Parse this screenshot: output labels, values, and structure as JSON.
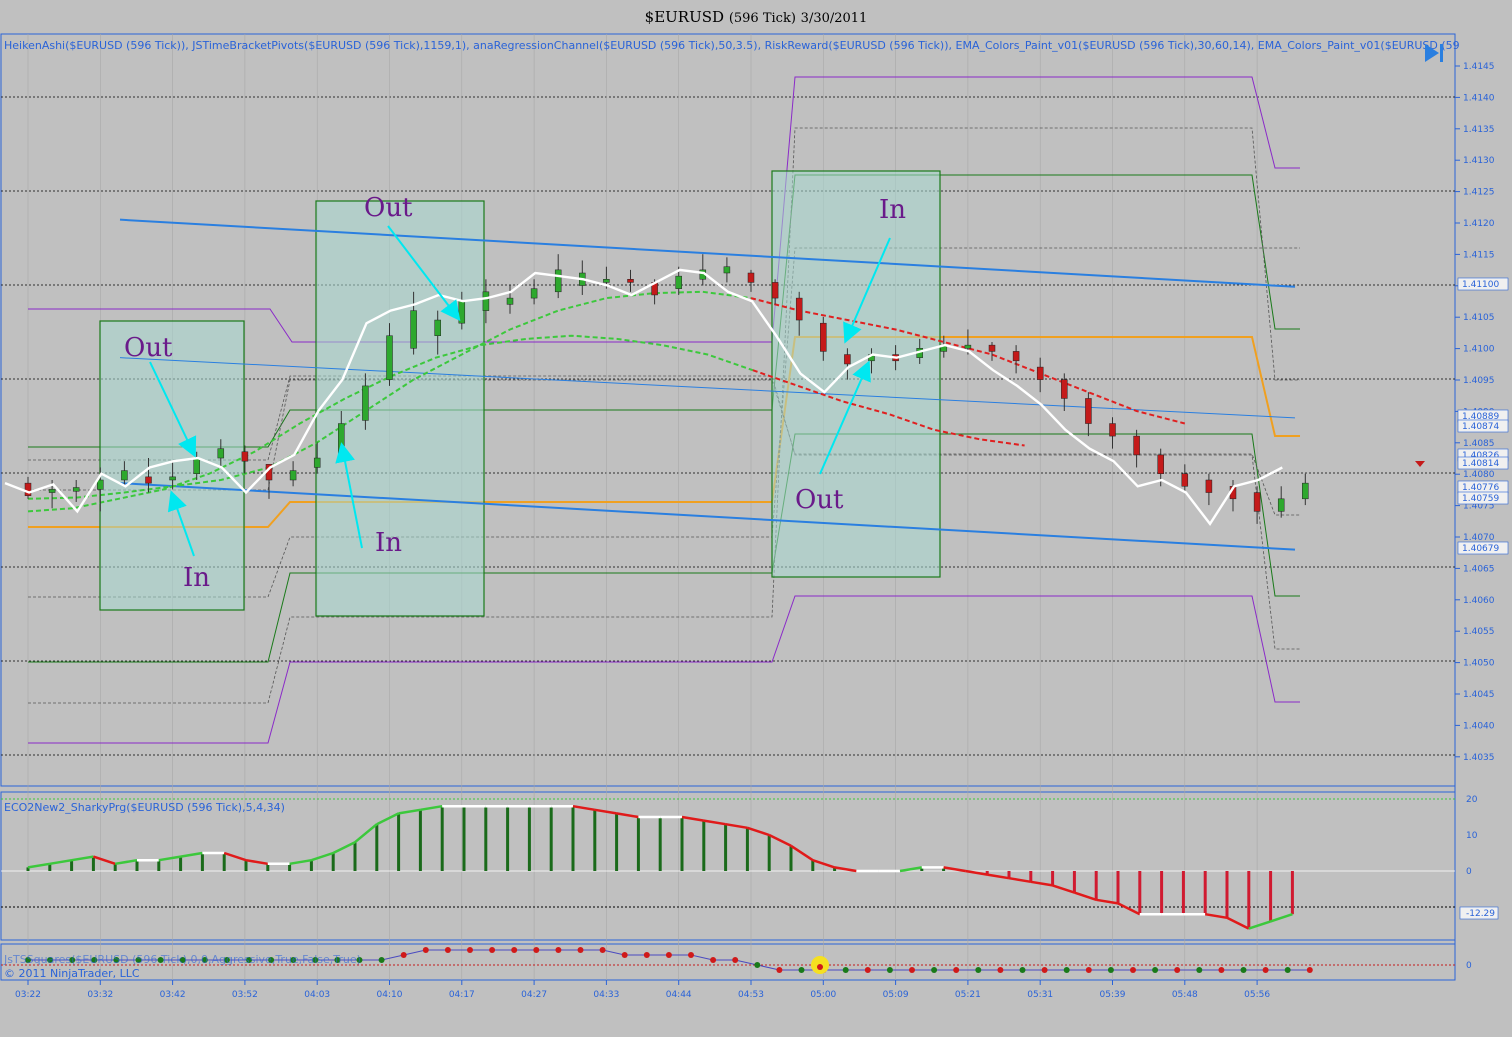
{
  "window": {
    "title_symbol": "$EURUSD",
    "title_period": "(596 Tick)",
    "title_date": "3/30/2011"
  },
  "panels": {
    "price_indicators_label": "HeikenAshi($EURUSD (596 Tick)), JSTimeBracketPivots($EURUSD (596 Tick),1159,1), anaRegressionChannel($EURUSD (596 Tick),50,3.5), RiskReward($EURUSD (596 Tick)), EMA_Colors_Paint_v01($EURUSD (596 Tick),30,60,14), EMA_Colors_Paint_v01($EURUSD (59",
    "osc_label": "ECO2New2_SharkyPrg($EURUSD (596 Tick),5,4,34)",
    "bottom_label": "JsTSSquares($EURUSD (596 Tick),0,0,Aggressive,True,False,True)",
    "copyright": "© 2011 NinjaTrader, LLC"
  },
  "colors": {
    "background": "#c0c0c0",
    "axis_text": "#2a63d8",
    "regression": "#2a7fe0",
    "annotation": "#6a1a8a",
    "arrow": "#00e8f0",
    "up_bar": "#2ea82e",
    "down_bar": "#c41a1a"
  },
  "chart_data": {
    "type": "candlestick",
    "x_tick_labels": [
      "03:22",
      "03:32",
      "03:42",
      "03:52",
      "04:03",
      "04:10",
      "04:17",
      "04:27",
      "04:33",
      "04:44",
      "04:53",
      "05:00",
      "05:09",
      "05:21",
      "05:31",
      "05:39",
      "05:48",
      "05:56"
    ],
    "y_tick_labels": [
      "1.4145",
      "1.4140",
      "1.4135",
      "1.4130",
      "1.4125",
      "1.4120",
      "1.4115",
      "1.4110",
      "1.4105",
      "1.4100",
      "1.4095",
      "1.4090",
      "1.4085",
      "1.4080",
      "1.4075",
      "1.4070",
      "1.4065",
      "1.4060",
      "1.4055",
      "1.4050",
      "1.4045",
      "1.4040",
      "1.4035"
    ],
    "price_labels": [
      "1.41100",
      "1.40889",
      "1.40874",
      "1.40826",
      "1.40814",
      "1.40776",
      "1.40759",
      "1.40679"
    ],
    "ylim": [
      1.40325,
      1.41475
    ],
    "osc_tick_labels": [
      "20",
      "10",
      "0",
      "-12.29"
    ],
    "bottom_tick_labels": [
      "0"
    ],
    "annotations": [
      "Out",
      "In",
      "Out",
      "In",
      "In",
      "Out"
    ],
    "regression_channel": {
      "upper": [
        [
          120,
          1.41205
        ],
        [
          1295,
          1.41098
        ]
      ],
      "lower": [
        [
          120,
          1.40785
        ],
        [
          1295,
          1.40679
        ]
      ],
      "middle": [
        [
          120,
          1.40985
        ],
        [
          1295,
          1.40889
        ]
      ]
    },
    "candles": [
      [
        1.40785,
        1.40765,
        1.40795,
        1.4076
      ],
      [
        1.4077,
        1.40775,
        1.4079,
        1.40745
      ],
      [
        1.40772,
        1.40778,
        1.4079,
        1.40755
      ],
      [
        1.40775,
        1.4079,
        1.4081,
        1.4074
      ],
      [
        1.4079,
        1.40805,
        1.4082,
        1.4078
      ],
      [
        1.40795,
        1.40785,
        1.40825,
        1.4077
      ],
      [
        1.4079,
        1.40795,
        1.4082,
        1.40775
      ],
      [
        1.408,
        1.40825,
        1.40835,
        1.4079
      ],
      [
        1.40825,
        1.4084,
        1.40855,
        1.4081
      ],
      [
        1.40835,
        1.4082,
        1.40845,
        1.408
      ],
      [
        1.40815,
        1.4079,
        1.40815,
        1.4076
      ],
      [
        1.4079,
        1.40805,
        1.4082,
        1.4078
      ],
      [
        1.4081,
        1.40825,
        1.4085,
        1.408
      ],
      [
        1.4083,
        1.4088,
        1.409,
        1.4082
      ],
      [
        1.40885,
        1.4094,
        1.4096,
        1.4087
      ],
      [
        1.4095,
        1.4102,
        1.4104,
        1.4094
      ],
      [
        1.41,
        1.4106,
        1.4109,
        1.4099
      ],
      [
        1.4102,
        1.41045,
        1.4106,
        1.4099
      ],
      [
        1.4104,
        1.41075,
        1.4109,
        1.4103
      ],
      [
        1.4106,
        1.4109,
        1.4111,
        1.4104
      ],
      [
        1.4107,
        1.4108,
        1.411,
        1.41055
      ],
      [
        1.4108,
        1.41095,
        1.4111,
        1.4107
      ],
      [
        1.4109,
        1.41125,
        1.4115,
        1.4108
      ],
      [
        1.411,
        1.4112,
        1.4114,
        1.41085
      ],
      [
        1.41105,
        1.4111,
        1.4113,
        1.41095
      ],
      [
        1.4111,
        1.41105,
        1.41125,
        1.4109
      ],
      [
        1.41105,
        1.41085,
        1.4111,
        1.4107
      ],
      [
        1.41095,
        1.41115,
        1.4113,
        1.41085
      ],
      [
        1.4111,
        1.41125,
        1.4115,
        1.411
      ],
      [
        1.4112,
        1.4113,
        1.41145,
        1.41105
      ],
      [
        1.4112,
        1.41105,
        1.41125,
        1.4109
      ],
      [
        1.41105,
        1.4108,
        1.4111,
        1.4107
      ],
      [
        1.4108,
        1.41045,
        1.4109,
        1.4102
      ],
      [
        1.4104,
        1.40995,
        1.4105,
        1.4098
      ],
      [
        1.4099,
        1.40975,
        1.41,
        1.4095
      ],
      [
        1.4098,
        1.4099,
        1.41,
        1.4096
      ],
      [
        1.4099,
        1.4098,
        1.41005,
        1.40965
      ],
      [
        1.40985,
        1.41,
        1.41015,
        1.40975
      ],
      [
        1.40995,
        1.41005,
        1.4102,
        1.40985
      ],
      [
        1.41,
        1.41005,
        1.4103,
        1.4099
      ],
      [
        1.41005,
        1.40995,
        1.4101,
        1.4098
      ],
      [
        1.40995,
        1.4098,
        1.41005,
        1.4096
      ],
      [
        1.4097,
        1.4095,
        1.40985,
        1.4093
      ],
      [
        1.4095,
        1.4092,
        1.4096,
        1.409
      ],
      [
        1.4092,
        1.4088,
        1.4093,
        1.4086
      ],
      [
        1.4088,
        1.4086,
        1.4089,
        1.4084
      ],
      [
        1.4086,
        1.4083,
        1.4087,
        1.4081
      ],
      [
        1.4083,
        1.408,
        1.4084,
        1.4078
      ],
      [
        1.408,
        1.4078,
        1.40815,
        1.4077
      ],
      [
        1.4079,
        1.4077,
        1.408,
        1.4075
      ],
      [
        1.4078,
        1.4076,
        1.4079,
        1.4074
      ],
      [
        1.4077,
        1.4074,
        1.4078,
        1.4072
      ],
      [
        1.4074,
        1.4076,
        1.4078,
        1.4073
      ],
      [
        1.4076,
        1.40785,
        1.408,
        1.4075
      ]
    ],
    "heiken_close_line": [
      1.40785,
      1.4077,
      1.40783,
      1.4074,
      1.408,
      1.4078,
      1.4081,
      1.4082,
      1.40825,
      1.4081,
      1.4077,
      1.4081,
      1.4083,
      1.409,
      1.4095,
      1.4104,
      1.4106,
      1.4107,
      1.41085,
      1.41075,
      1.4108,
      1.4109,
      1.4112,
      1.41115,
      1.4111,
      1.411,
      1.41085,
      1.41105,
      1.41125,
      1.4112,
      1.4109,
      1.41075,
      1.4102,
      1.4096,
      1.4093,
      1.4097,
      1.4099,
      1.40985,
      1.40995,
      1.41005,
      1.40995,
      1.40965,
      1.4094,
      1.4091,
      1.4087,
      1.4084,
      1.4082,
      1.4078,
      1.4079,
      1.4077,
      1.4072,
      1.4078,
      1.4079,
      1.4081
    ],
    "ema_fast": [
      1.4076,
      1.40762,
      1.4077,
      1.4078,
      1.4079,
      1.4081,
      1.4085,
      1.409,
      1.4095,
      1.4099,
      1.4103,
      1.4106,
      1.4108,
      1.41088,
      1.4109,
      1.4108,
      1.4106,
      1.41045,
      1.4103,
      1.4101,
      1.4099,
      1.4096,
      1.4093,
      1.409,
      1.4088
    ],
    "ema_slow": [
      1.4074,
      1.40745,
      1.4076,
      1.40775,
      1.408,
      1.40835,
      1.4088,
      1.4092,
      1.40955,
      1.40985,
      1.41005,
      1.41015,
      1.4102,
      1.41015,
      1.41005,
      1.4099,
      1.40965,
      1.4094,
      1.40915,
      1.40895,
      1.4087,
      1.40855,
      1.40845
    ],
    "osc_values": [
      1,
      2,
      3,
      4,
      2,
      3,
      3,
      4,
      5,
      5,
      3,
      2,
      2,
      3,
      5,
      8,
      13,
      16,
      17,
      18,
      18,
      18,
      18,
      18,
      18,
      18,
      17,
      16,
      15,
      15,
      15,
      14,
      13,
      12,
      10,
      7,
      3,
      1,
      0,
      0,
      0,
      1,
      1,
      0,
      -1,
      -2,
      -3,
      -4,
      -6,
      -8,
      -9,
      -12,
      -12,
      -12,
      -12,
      -13,
      -16,
      -14,
      -12
    ],
    "squares": [
      1,
      1,
      1,
      1,
      1,
      1,
      1,
      1,
      1,
      1,
      1,
      1,
      1,
      1,
      1,
      1,
      1,
      2,
      3,
      3,
      3,
      3,
      3,
      3,
      3,
      3,
      3,
      2,
      2,
      2,
      2,
      1,
      1,
      0,
      -1,
      -1,
      -1,
      -1,
      -1,
      -1,
      -1,
      -1,
      -1,
      -1,
      -1,
      -1,
      -1,
      -1,
      -1,
      -1,
      -1,
      -1,
      -1,
      -1,
      -1,
      -1,
      -1,
      -1,
      -1
    ]
  }
}
